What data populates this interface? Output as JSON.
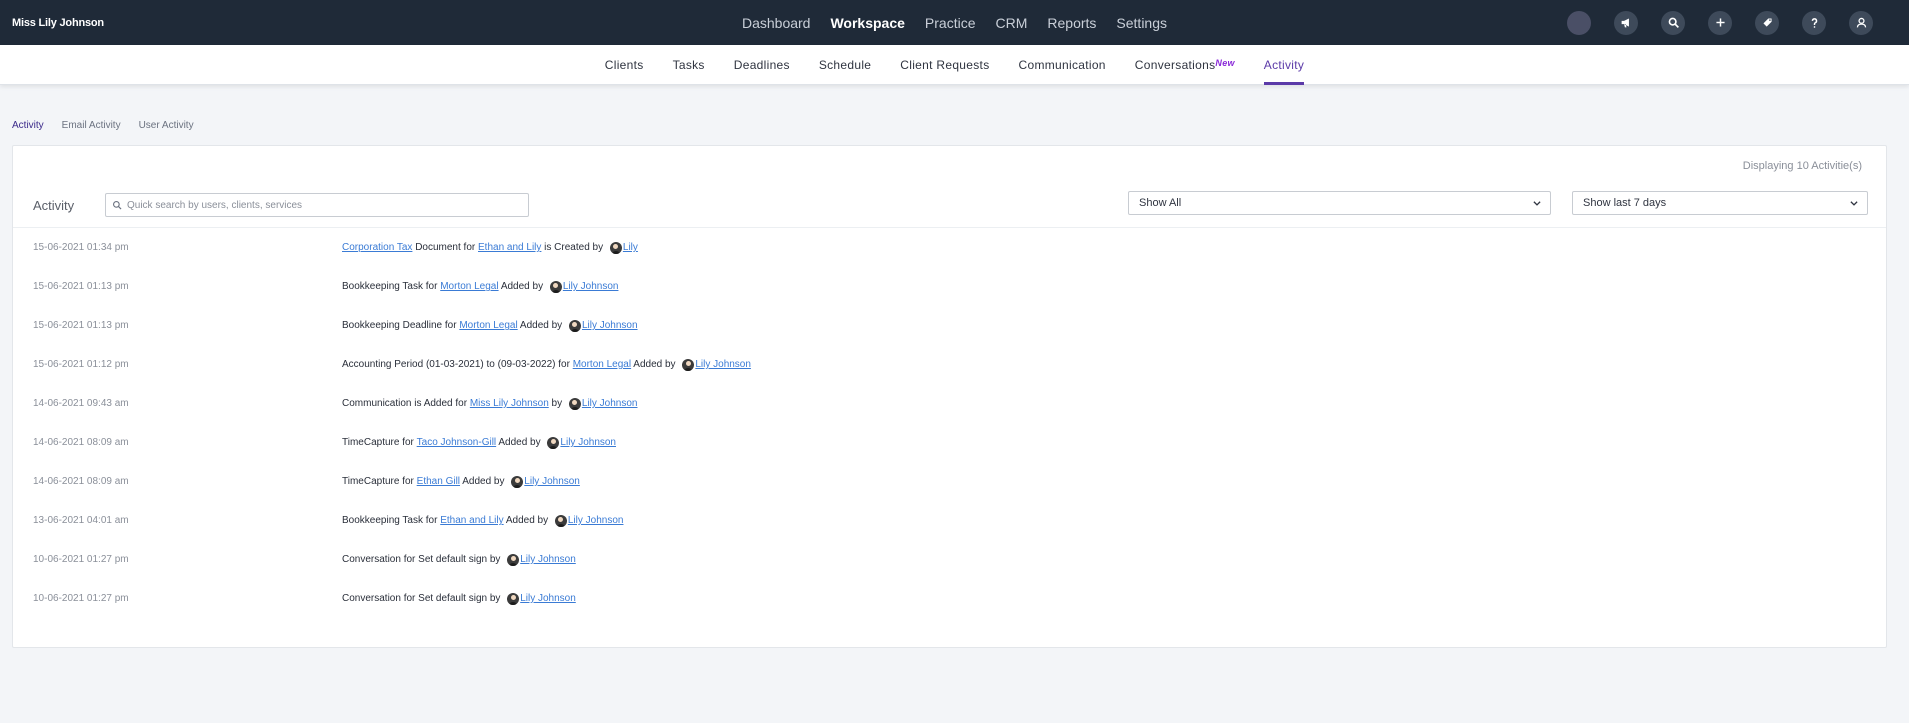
{
  "topbar": {
    "user_name": "Miss Lily Johnson",
    "nav": [
      "Dashboard",
      "Workspace",
      "Practice",
      "CRM",
      "Reports",
      "Settings"
    ],
    "active_nav": "Workspace"
  },
  "subnav": {
    "items": [
      "Clients",
      "Tasks",
      "Deadlines",
      "Schedule",
      "Client Requests",
      "Communication",
      "Conversations",
      "Activity"
    ],
    "new_badge": "New",
    "active": "Activity"
  },
  "section_tabs": [
    "Activity",
    "Email Activity",
    "User Activity"
  ],
  "panel": {
    "displaying": "Displaying 10 Activitie(s)",
    "title": "Activity",
    "search_placeholder": "Quick search by users, clients, services",
    "filter_value": "Show All",
    "range_value": "Show last 7 days"
  },
  "activities": [
    {
      "ts": "15-06-2021 01:34 pm",
      "parts": [
        [
          "link",
          "Corporation Tax"
        ],
        [
          "text",
          " Document for "
        ],
        [
          "link",
          "Ethan and Lily"
        ],
        [
          "text",
          " is Created by "
        ],
        [
          "avatar",
          ""
        ],
        [
          "link",
          "Lily"
        ]
      ]
    },
    {
      "ts": "15-06-2021 01:13 pm",
      "parts": [
        [
          "text",
          "Bookkeeping Task for "
        ],
        [
          "link",
          "Morton Legal"
        ],
        [
          "text",
          " Added by "
        ],
        [
          "avatar",
          ""
        ],
        [
          "link",
          "Lily Johnson"
        ]
      ]
    },
    {
      "ts": "15-06-2021 01:13 pm",
      "parts": [
        [
          "text",
          "Bookkeeping Deadline for "
        ],
        [
          "link",
          "Morton Legal"
        ],
        [
          "text",
          " Added by "
        ],
        [
          "avatar",
          ""
        ],
        [
          "link",
          "Lily Johnson"
        ]
      ]
    },
    {
      "ts": "15-06-2021 01:12 pm",
      "parts": [
        [
          "text",
          "Accounting Period (01-03-2021) to (09-03-2022) for "
        ],
        [
          "link",
          "Morton Legal"
        ],
        [
          "text",
          " Added by "
        ],
        [
          "avatar",
          ""
        ],
        [
          "link",
          "Lily Johnson"
        ]
      ]
    },
    {
      "ts": "14-06-2021 09:43 am",
      "parts": [
        [
          "text",
          "Communication is Added for "
        ],
        [
          "link",
          "Miss Lily Johnson"
        ],
        [
          "text",
          " by "
        ],
        [
          "avatar",
          ""
        ],
        [
          "link",
          "Lily Johnson"
        ]
      ]
    },
    {
      "ts": "14-06-2021 08:09 am",
      "parts": [
        [
          "text",
          "TimeCapture for "
        ],
        [
          "link",
          "Taco Johnson-Gill"
        ],
        [
          "text",
          " Added by "
        ],
        [
          "avatar",
          ""
        ],
        [
          "link",
          "Lily Johnson"
        ]
      ]
    },
    {
      "ts": "14-06-2021 08:09 am",
      "parts": [
        [
          "text",
          "TimeCapture for "
        ],
        [
          "link",
          "Ethan Gill"
        ],
        [
          "text",
          " Added by "
        ],
        [
          "avatar",
          ""
        ],
        [
          "link",
          "Lily Johnson"
        ]
      ]
    },
    {
      "ts": "13-06-2021 04:01 am",
      "parts": [
        [
          "text",
          "Bookkeeping Task for "
        ],
        [
          "link",
          "Ethan and Lily"
        ],
        [
          "text",
          " Added by "
        ],
        [
          "avatar",
          ""
        ],
        [
          "link",
          "Lily Johnson"
        ]
      ]
    },
    {
      "ts": "10-06-2021 01:27 pm",
      "parts": [
        [
          "text",
          "Conversation for Set default sign by "
        ],
        [
          "avatar",
          ""
        ],
        [
          "link",
          "Lily Johnson"
        ]
      ]
    },
    {
      "ts": "10-06-2021 01:27 pm",
      "parts": [
        [
          "text",
          "Conversation for Set default sign by "
        ],
        [
          "avatar",
          ""
        ],
        [
          "link",
          "Lily Johnson"
        ]
      ]
    }
  ]
}
